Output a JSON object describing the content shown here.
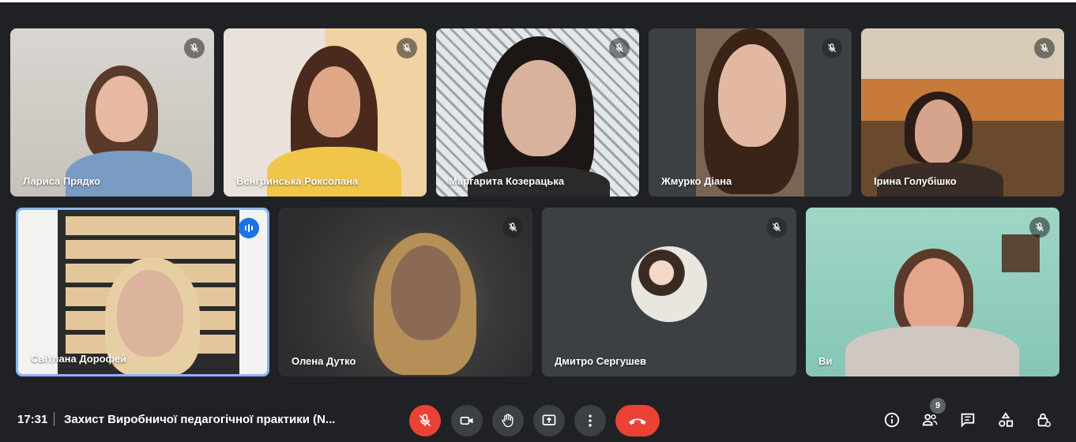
{
  "participants": [
    {
      "name": "Лариса Прядко",
      "muted": true
    },
    {
      "name": "Венгринська Роксолана",
      "muted": true
    },
    {
      "name": "Маргарита Козерацька",
      "muted": true
    },
    {
      "name": "Жмурко Діана",
      "muted": true
    },
    {
      "name": "Ірина Голубішко",
      "muted": true
    },
    {
      "name": "Світлана Дорофей",
      "speaking": true
    },
    {
      "name": "Олена Дутко",
      "muted": true
    },
    {
      "name": "Дмитро Сергушев",
      "muted": true
    },
    {
      "name": "Ви",
      "muted": true
    }
  ],
  "bottom_bar": {
    "time": "17:31",
    "meeting_title": "Захист Виробничої педагогічної практики (N...",
    "people_count": "9"
  },
  "icons": {
    "mic_off": "mic-off-icon",
    "camera": "camera-icon",
    "raise_hand": "raise-hand-icon",
    "present": "present-screen-icon",
    "more": "more-options-icon",
    "end_call": "end-call-icon",
    "info": "info-icon",
    "people": "people-icon",
    "chat": "chat-icon",
    "activities": "activities-icon",
    "host_controls": "host-controls-icon"
  },
  "colors": {
    "background": "#202124",
    "tile": "#3c4043",
    "active_border": "#8ab4f8",
    "danger": "#ea4335",
    "speaking": "#1a73e8"
  }
}
